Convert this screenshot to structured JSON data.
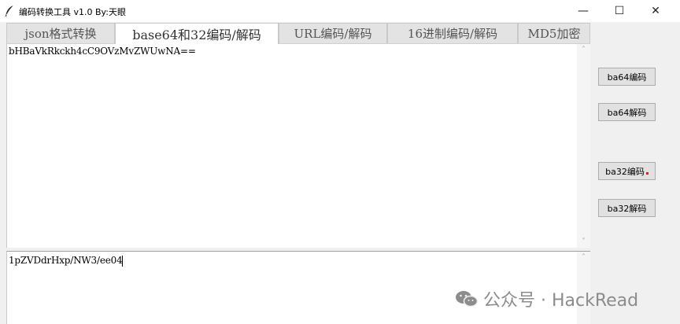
{
  "window": {
    "title": "编码转换工具 v1.0    By:天眼",
    "min_glyph": "—",
    "max_glyph": "☐",
    "close_glyph": "✕"
  },
  "tabs": [
    {
      "label": "json格式转换"
    },
    {
      "label": "base64和32编码/解码"
    },
    {
      "label": "URL编码/解码"
    },
    {
      "label": "16进制编码/解码"
    },
    {
      "label": "MD5加密"
    }
  ],
  "active_tab": 1,
  "input_pane": {
    "text": "bHBaVkRkckh4cC9OVzMvZWUwNA==",
    "scroll_up": "˄",
    "scroll_down": "˅"
  },
  "output_pane": {
    "text": "1pZVDdrHxp/NW3/ee04",
    "scroll_up": "˄"
  },
  "buttons": {
    "b64_encode": "ba64编码",
    "b64_decode": "ba64解码",
    "b32_encode": "ba32编码",
    "b32_decode": "ba32解码"
  },
  "watermark": {
    "text": "公众号 · HackRead"
  },
  "colors": {
    "accent_dot": "#e02020",
    "background": "#f0f0f0"
  }
}
